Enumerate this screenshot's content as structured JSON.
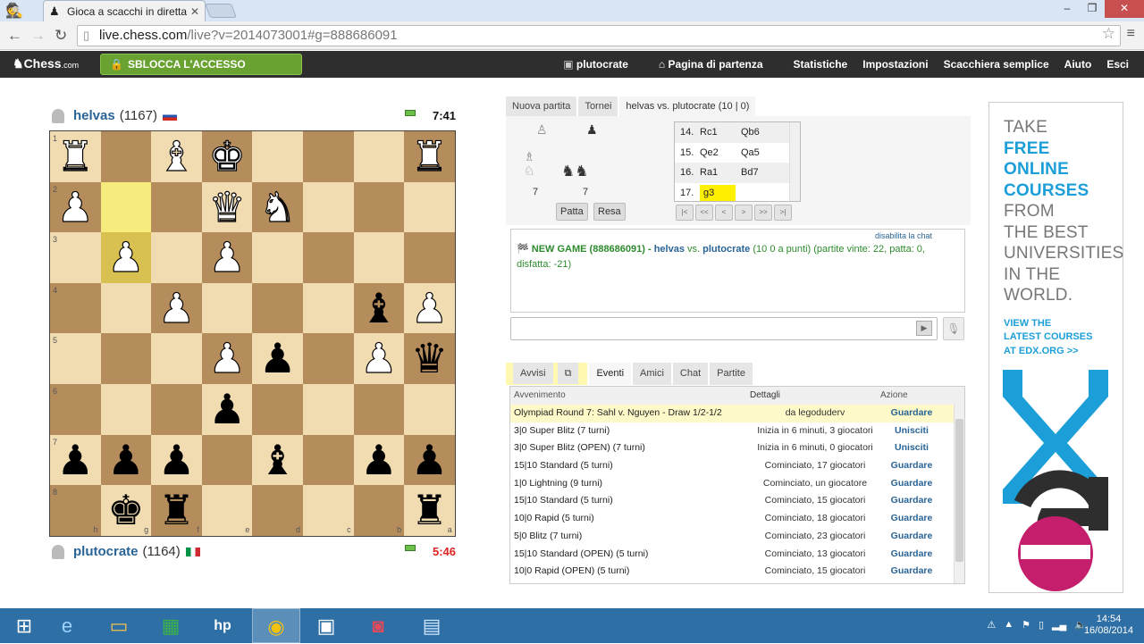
{
  "browser": {
    "tab_title": "Gioca a scacchi in diretta",
    "url_domain": "live.chess.com",
    "url_path": "/live?v=2014073001#g=888686091"
  },
  "site": {
    "logo": "Chess",
    "logo_suffix": ".com",
    "unlock_label": "SBLOCCA L'ACCESSO COMPLETO",
    "user": "plutocrate",
    "nav": [
      "Pagina di partenza",
      "Statistiche",
      "Impostazioni",
      "Scacchiera semplice",
      "Aiuto",
      "Esci"
    ]
  },
  "top_player": {
    "name": "helvas",
    "rating": "(1167)",
    "clock": "7:41",
    "flag_colors": [
      "#ffffff",
      "#2456b0",
      "#d52b1e"
    ]
  },
  "bottom_player": {
    "name": "plutocrate",
    "rating": "(1164)",
    "clock": "5:46",
    "flag_colors": [
      "#009246",
      "#ffffff",
      "#ce2b37"
    ]
  },
  "board": {
    "ranks": [
      "1",
      "2",
      "3",
      "4",
      "5",
      "6",
      "7",
      "8"
    ],
    "files": [
      "h",
      "g",
      "f",
      "e",
      "d",
      "c",
      "b",
      "a"
    ],
    "rows": [
      [
        "wR",
        "",
        "wB",
        "wK",
        "",
        "",
        "",
        "wR"
      ],
      [
        "wP",
        "",
        "",
        "wQ",
        "wN",
        "",
        "",
        ""
      ],
      [
        "",
        "wP",
        "",
        "wP",
        "",
        "",
        "",
        ""
      ],
      [
        "",
        "",
        "wP",
        "",
        "",
        "",
        "bB",
        "wP"
      ],
      [
        "",
        "",
        "",
        "wP",
        "bP",
        "",
        "wP",
        "bQ"
      ],
      [
        "",
        "",
        "",
        "bP",
        "",
        "",
        "",
        ""
      ],
      [
        "bP",
        "bP",
        "bP",
        "",
        "bB",
        "",
        "bP",
        "bP"
      ],
      [
        "",
        "bK",
        "bR",
        "",
        "",
        "",
        "",
        "bR"
      ]
    ],
    "highlight": [
      [
        1,
        1
      ],
      [
        2,
        1
      ]
    ]
  },
  "right_tabs": [
    "Nuova partita",
    "Tornei",
    "helvas vs. plutocrate (10 | 0)"
  ],
  "captured": {
    "white_count": "7",
    "black_count": "7"
  },
  "buttons": {
    "draw": "Patta",
    "resign": "Resa"
  },
  "moves": [
    {
      "n": "14.",
      "w": "Rc1",
      "b": "Qb6"
    },
    {
      "n": "15.",
      "w": "Qe2",
      "b": "Qa5"
    },
    {
      "n": "16.",
      "w": "Ra1",
      "b": "Bd7"
    },
    {
      "n": "17.",
      "w": "g3",
      "b": ""
    }
  ],
  "nav_buttons": [
    "|<",
    "<<",
    "<",
    ">",
    ">>",
    ">|"
  ],
  "chat": {
    "disable": "disabilita la chat",
    "msg_head": "NEW GAME (888686091) - ",
    "msg_p1": "helvas",
    "msg_vs": " vs. ",
    "msg_p2": "plutocrate",
    "msg_tail": " (10 0 a punti) (partite vinte: 22, patta: 0, disfatta: -21)"
  },
  "lower_tabs": [
    "Avvisi",
    "Eventi",
    "Amici",
    "Chat",
    "Partite"
  ],
  "events": {
    "headers": [
      "Avvenimento",
      "Dettagli",
      "Azione"
    ],
    "rows": [
      {
        "name": "Olympiad Round 7: Sahl v. Nguyen - Draw 1/2-1/2",
        "details": "da legoduderv",
        "action": "Guardare"
      },
      {
        "name": "3|0 Super Blitz (7 turni)",
        "details": "Inizia in 6 minuti, 3 giocatori",
        "action": "Unisciti"
      },
      {
        "name": "3|0 Super Blitz (OPEN) (7 turni)",
        "details": "Inizia in 6 minuti, 0 giocatori",
        "action": "Unisciti"
      },
      {
        "name": "15|10 Standard (5 turni)",
        "details": "Cominciato, 17 giocatori",
        "action": "Guardare"
      },
      {
        "name": "1|0 Lightning (9 turni)",
        "details": "Cominciato, un giocatore",
        "action": "Guardare"
      },
      {
        "name": "15|10 Standard (5 turni)",
        "details": "Cominciato, 15 giocatori",
        "action": "Guardare"
      },
      {
        "name": "10|0 Rapid (5 turni)",
        "details": "Cominciato, 18 giocatori",
        "action": "Guardare"
      },
      {
        "name": "5|0 Blitz (7 turni)",
        "details": "Cominciato, 23 giocatori",
        "action": "Guardare"
      },
      {
        "name": "15|10 Standard (OPEN) (5 turni)",
        "details": "Cominciato, 13 giocatori",
        "action": "Guardare"
      },
      {
        "name": "10|0 Rapid (OPEN) (5 turni)",
        "details": "Cominciato, 15 giocatori",
        "action": "Guardare"
      }
    ]
  },
  "ad": {
    "lines": [
      "TAKE",
      "FREE",
      "ONLINE",
      "COURSES",
      "FROM",
      "THE BEST",
      "UNIVERSITIES",
      "IN THE",
      "WORLD."
    ],
    "link_lines": [
      "VIEW THE",
      "LATEST COURSES",
      "AT EDX.ORG >>"
    ],
    "brand_colors": [
      "#1c9fd8",
      "#c41e6c"
    ]
  },
  "taskbar": {
    "time": "14:54",
    "date": "16/08/2014"
  },
  "colors": {
    "light_square": "#f1dcb2",
    "dark_square": "#b58c5c",
    "highlight": "#f5ec7d",
    "link": "#2a6496",
    "unlock": "#6aa232"
  }
}
